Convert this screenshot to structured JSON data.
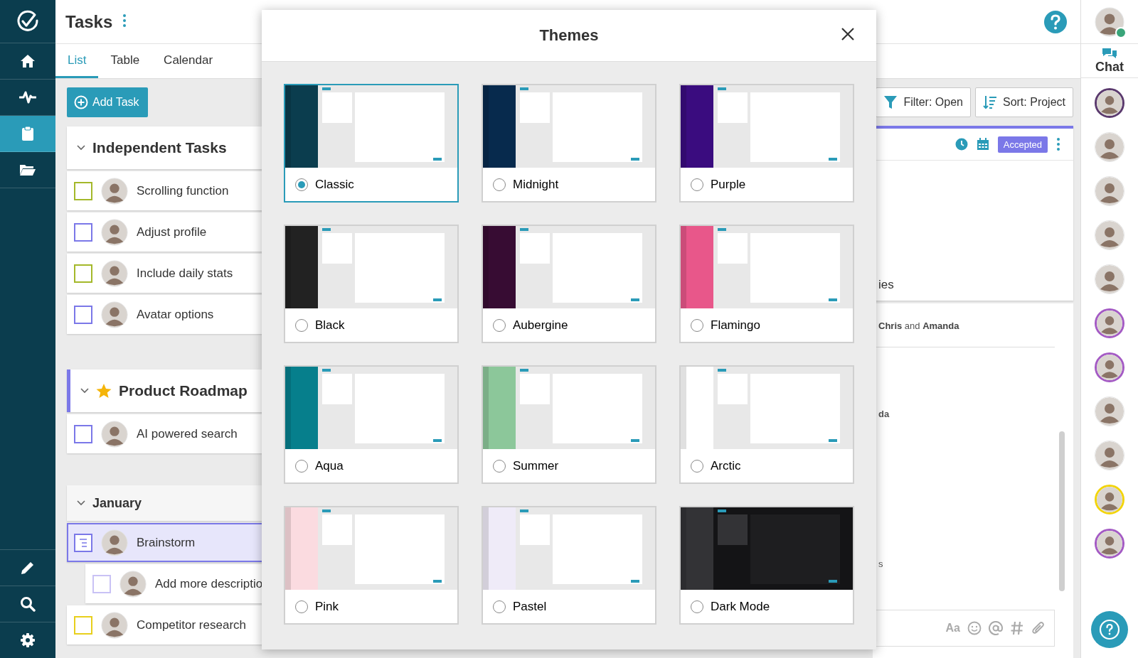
{
  "nav": {
    "items": [
      {
        "kind": "home",
        "selected": false
      },
      {
        "kind": "activity",
        "selected": false
      },
      {
        "kind": "clipboard",
        "selected": true
      },
      {
        "kind": "folder",
        "selected": false
      }
    ],
    "bottom_items": [
      {
        "kind": "pencil"
      },
      {
        "kind": "search"
      },
      {
        "kind": "settings"
      }
    ]
  },
  "header": {
    "title": "Tasks"
  },
  "tabs": [
    {
      "label": "List",
      "selected": true
    },
    {
      "label": "Table",
      "selected": false
    },
    {
      "label": "Calendar",
      "selected": false
    }
  ],
  "add_task": {
    "label": "Add Task"
  },
  "sections": [
    {
      "title": "Independent Tasks",
      "kind": "project",
      "starred": false,
      "tasks": [
        {
          "title": "Scrolling function",
          "kind": "checkbox",
          "color": "#a4b82a",
          "selected": false
        },
        {
          "title": "Adjust profile",
          "kind": "checkbox",
          "color": "#7b78e8",
          "selected": false
        },
        {
          "title": "Include daily stats",
          "kind": "checkbox",
          "color": "#a4b82a",
          "selected": false
        },
        {
          "title": "Avatar options",
          "kind": "checkbox",
          "color": "#7b78e8",
          "selected": false
        }
      ]
    },
    {
      "title": "Product Roadmap",
      "kind": "project",
      "starred": true,
      "color": "#7b78e8",
      "tasks": [
        {
          "title": "AI powered search",
          "kind": "checkbox",
          "color": "#7b78e8",
          "selected": false
        }
      ]
    },
    {
      "title": "January",
      "kind": "group",
      "starred": false,
      "tasks": [
        {
          "title": "Brainstorm",
          "kind": "note",
          "color": "#7b78e8",
          "selected": true,
          "children": [
            {
              "title": "Add more descriptio",
              "kind": "checkbox",
              "color": "#c9c2f5",
              "selected": false
            }
          ]
        },
        {
          "title": "Competitor research",
          "kind": "checkbox",
          "color": "#e8cf1c",
          "selected": false
        }
      ]
    }
  ],
  "toolbar": {
    "filter": "Filter: Open",
    "sort": "Sort: Project"
  },
  "detail": {
    "status": "Accepted",
    "description_end": "ies",
    "members": "**Chris** and **Amanda**",
    "activity_line_end": "da",
    "comment_end": "s",
    "composer_format": "Aa"
  },
  "user": {
    "online": true
  },
  "chat": {
    "label": "Chat",
    "contacts": [
      {
        "ring": true,
        "color": "#5b3a6e"
      },
      {
        "ring": false
      },
      {
        "ring": false
      },
      {
        "ring": false
      },
      {
        "ring": false
      },
      {
        "ring": true,
        "color": "#a45bc4"
      },
      {
        "ring": true,
        "color": "#a45bc4"
      },
      {
        "ring": false
      },
      {
        "ring": false
      },
      {
        "ring": true,
        "color": "#f2d40c"
      },
      {
        "ring": true,
        "color": "#a45bc4"
      }
    ]
  },
  "modal": {
    "title": "Themes",
    "themes": [
      {
        "name": "Classic",
        "color": "#0b3d4e",
        "kind": "light",
        "selected": true
      },
      {
        "name": "Midnight",
        "color": "#072a4d",
        "kind": "light",
        "selected": false
      },
      {
        "name": "Purple",
        "color": "#3a0c7f",
        "kind": "light",
        "selected": false
      },
      {
        "name": "Black",
        "color": "#222222",
        "kind": "light",
        "selected": false
      },
      {
        "name": "Aubergine",
        "color": "#370c33",
        "kind": "light",
        "selected": false
      },
      {
        "name": "Flamingo",
        "color": "#e8578a",
        "kind": "light",
        "selected": false
      },
      {
        "name": "Aqua",
        "color": "#067f8c",
        "kind": "light",
        "selected": false
      },
      {
        "name": "Summer",
        "color": "#8cc79a",
        "kind": "light",
        "selected": false
      },
      {
        "name": "Arctic",
        "color": "#ffffff",
        "kind": "light",
        "selected": false
      },
      {
        "name": "Pink",
        "color": "#fbdbe0",
        "kind": "light",
        "selected": false
      },
      {
        "name": "Pastel",
        "color": "#efebf8",
        "kind": "light",
        "selected": false
      },
      {
        "name": "Dark Mode",
        "color": "#333336",
        "kind": "dark",
        "selected": false
      }
    ]
  }
}
